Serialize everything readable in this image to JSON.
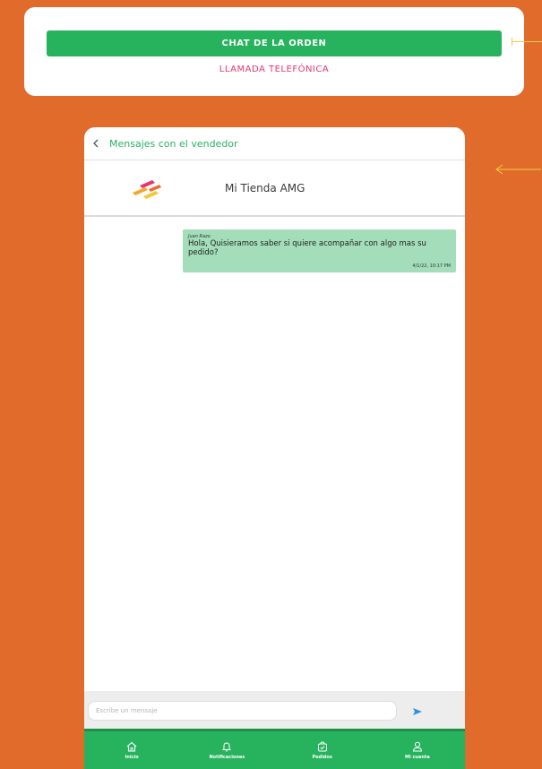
{
  "top_card": {
    "chat_button_label": "CHAT DE LA ORDEN",
    "call_link_label": "LLAMADA TELEFÓNICA"
  },
  "app": {
    "header_title": "Mensajes con el vendedor",
    "store_name": "Mi Tienda AMG",
    "messages": [
      {
        "author": "Juan Razo",
        "text": "Hola, Quisieramos saber si quiere acompañar con algo mas su pedido?",
        "time": "4/1/22, 10:17 PM"
      }
    ],
    "composer": {
      "placeholder": "Escribe un mensaje"
    },
    "tabs": [
      {
        "label": "Inicio",
        "icon": "home-icon"
      },
      {
        "label": "Notificaciones",
        "icon": "bell-icon"
      },
      {
        "label": "Pedidos",
        "icon": "orders-icon"
      },
      {
        "label": "Mi cuenta",
        "icon": "user-icon"
      }
    ]
  },
  "colors": {
    "background": "#E06B2B",
    "primary_green": "#27B35E",
    "bubble_green": "#A3DDB9",
    "call_pink": "#E9356B",
    "pointer_yellow": "#F5C843"
  }
}
